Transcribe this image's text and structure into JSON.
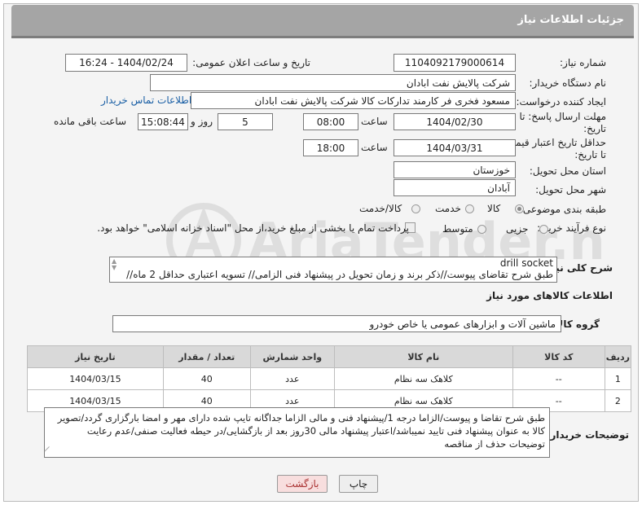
{
  "header": {
    "title": "جزئیات اطلاعات نیاز"
  },
  "fields": {
    "need_number": {
      "label": "شماره نیاز:",
      "value": "1104092179000614"
    },
    "announce_datetime": {
      "label": "تاریخ و ساعت اعلان عمومی:",
      "value": "1404/02/24 - 16:24"
    },
    "buyer_org": {
      "label": "نام دستگاه خریدار:",
      "value": "شرکت پالایش نفت ابادان"
    },
    "requester": {
      "label": "ایجاد کننده درخواست:",
      "value": "مسعود فخری فر کارمند تدارکات کالا شرکت پالایش نفت ابادان",
      "contact_link": "اطلاعات تماس خریدار"
    },
    "deadline": {
      "label_line1": "مهلت ارسال پاسخ: تا",
      "label_line2": "تاریخ:",
      "date": "1404/02/30",
      "time_label": "ساعت",
      "time": "08:00",
      "days": "5",
      "days_label": "روز و",
      "remaining": "15:08:44",
      "remaining_label": "ساعت باقی مانده"
    },
    "price_validity": {
      "label_line1": "حداقل تاریخ اعتبار قیمت:",
      "label_line2": "تا تاریخ:",
      "date": "1404/03/31",
      "time_label": "ساعت",
      "time": "18:00"
    },
    "delivery_province": {
      "label": "استان محل تحویل:",
      "value": "خوزستان"
    },
    "delivery_city": {
      "label": "شهر محل تحویل:",
      "value": "آبادان"
    },
    "category": {
      "label": "طبقه بندی موضوعی:",
      "options": [
        "کالا",
        "خدمت",
        "کالا/خدمت"
      ],
      "selected": "کالا"
    },
    "process_type": {
      "label": "نوع فرآیند خرید :",
      "options": [
        "جزیی",
        "متوسط"
      ],
      "payment_note": "پرداخت تمام یا بخشی از مبلغ خرید،از محل \"اسناد خزانه اسلامی\" خواهد بود."
    }
  },
  "description": {
    "label": "شرح کلی نیاز:",
    "line1": "drill socket",
    "line2": "طبق شرح تقاضای پیوست//ذکر برند و زمان تحویل در پیشنهاد فنی الزامی// تسویه اعتباری حداقل 2 ماه//"
  },
  "goods_info": {
    "title": "اطلاعات کالاهای مورد نیاز",
    "group_label": "گروه کالا:",
    "group_value": "ماشین آلات و ابزارهای عمومی یا خاص خودرو"
  },
  "table": {
    "headers": [
      "ردیف",
      "کد کالا",
      "نام کالا",
      "واحد شمارش",
      "تعداد / مقدار",
      "تاریخ نیاز"
    ],
    "rows": [
      [
        "1",
        "--",
        "کلاهک سه نظام",
        "عدد",
        "40",
        "1404/03/15"
      ],
      [
        "2",
        "--",
        "کلاهک سه نظام",
        "عدد",
        "40",
        "1404/03/15"
      ]
    ]
  },
  "buyer_notes": {
    "label": "توضیحات خریدار:",
    "line1": "طبق شرح تقاضا و پیوست/الزاما درجه 1/پیشنهاد فنی و مالی الزاما جداگانه تایپ شده دارای مهر و امضا بارگزاری گردد/تصویر",
    "line2": "کالا به عنوان پیشنهاد فنی تایید نمیباشد/اعتبار پیشنهاد مالی 30روز بعد از بازگشایی/در حیطه فعالیت صنفی/عدم رعایت",
    "line3": "توضیحات حذف از مناقصه"
  },
  "buttons": {
    "print": "چاپ",
    "back": "بازگشت"
  },
  "watermark": {
    "text": "AriaTender.net"
  }
}
